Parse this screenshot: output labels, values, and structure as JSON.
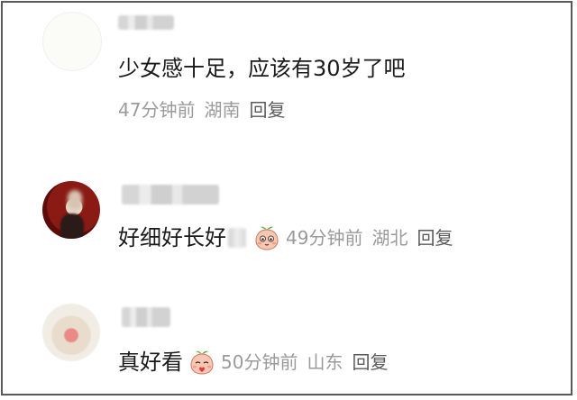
{
  "comments": [
    {
      "text": "少女感十足，应该有30岁了吧",
      "time": "47分钟前",
      "location": "湖南",
      "reply": "回复"
    },
    {
      "text": "好细好长好",
      "time": "49分钟前",
      "location": "湖北",
      "reply": "回复"
    },
    {
      "text": "真好看",
      "time": "50分钟前",
      "location": "山东",
      "reply": "回复"
    }
  ]
}
